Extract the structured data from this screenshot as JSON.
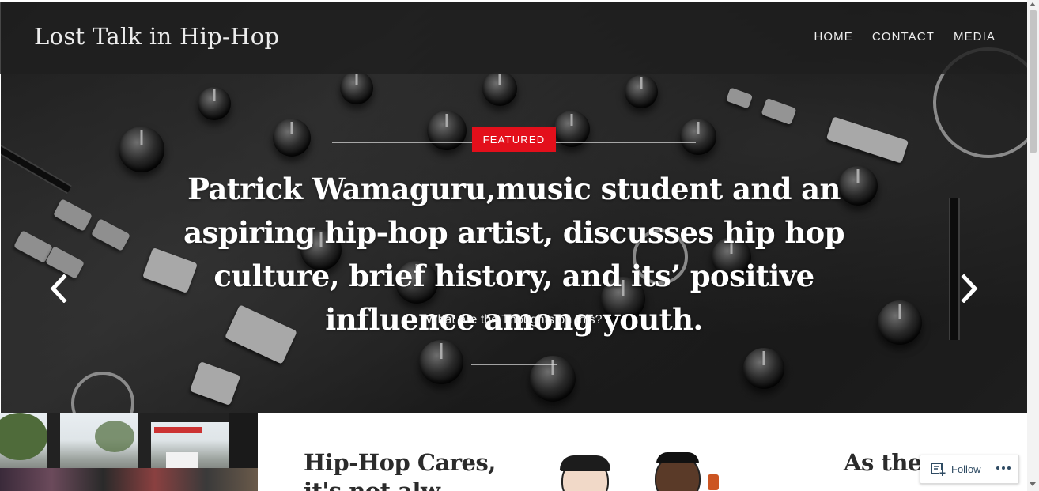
{
  "site": {
    "title": "Lost Talk in Hip-Hop"
  },
  "nav": {
    "items": [
      {
        "label": "HOME"
      },
      {
        "label": "CONTACT"
      },
      {
        "label": "MEDIA"
      }
    ]
  },
  "hero": {
    "badge": "FEATURED",
    "title": "Patrick Wamaguru,music student and an aspiring hip-hop artist, discusses hip hop culture, brief history, and its’ positive influence among youth.",
    "subtitle": "What are the Thoughts on this?",
    "prev_icon": "chevron-left-icon",
    "next_icon": "chevron-right-icon"
  },
  "posts": [
    {
      "title": "Hip-Hop Cares, it's not alw"
    },
    {
      "title": "As the t"
    }
  ],
  "follow": {
    "label": "Follow",
    "icon": "follow-reader-icon",
    "more_icon": "more-dots-icon"
  },
  "colors": {
    "accent": "#e30f1b",
    "header_bg": "#1e1e1e",
    "follow_text": "#2f4b63"
  }
}
